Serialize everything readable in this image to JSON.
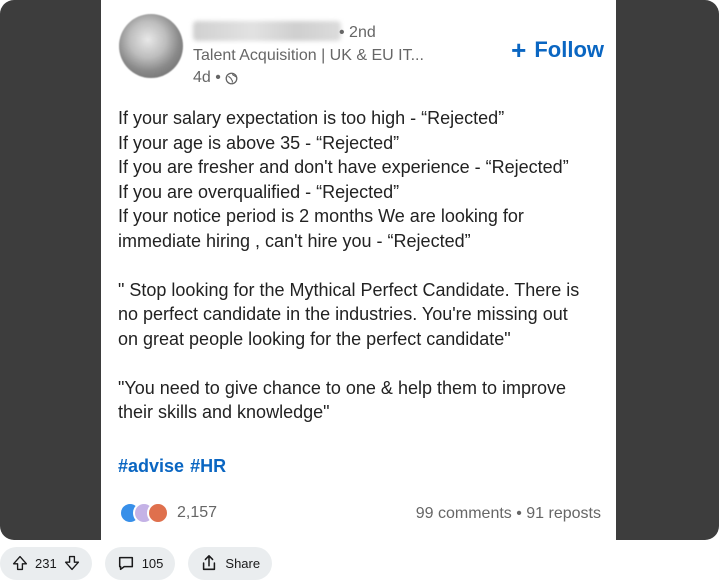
{
  "post": {
    "degree": "• 2nd",
    "headline": "Talent Acquisition | UK & EU IT...",
    "time": "4d •",
    "follow_label": "Follow",
    "body_lines": [
      "If your salary expectation is too high - “Rejected”",
      "If your age is above 35 - “Rejected”",
      "If you are fresher and don't have experience - “Rejected”",
      "If you are overqualified - “Rejected”",
      "If your notice period is 2 months We are looking for",
      "immediate hiring , can't hire you - “Rejected”",
      "",
      "\" Stop looking for the Mythical Perfect Candidate. There is",
      "no perfect candidate in the industries. You're missing out",
      "on great people looking for the perfect candidate\"",
      "",
      "\"You need to give chance to one & help them to improve",
      "their skills and knowledge\""
    ],
    "hashtags": [
      "#advise",
      "#HR"
    ],
    "reaction_count": "2,157",
    "social_counts": "99 comments • 91 reposts"
  },
  "actions": {
    "vote_count": "231",
    "comment_count": "105",
    "share_label": "Share"
  },
  "colors": {
    "link_blue": "#0a66c2",
    "media_bg": "#3d3d3d",
    "pill_bg": "#eaedef"
  },
  "icons": {
    "upvote": "arrow-up-icon",
    "downvote": "arrow-down-icon",
    "comment": "comment-bubble-icon",
    "share": "share-icon",
    "globe": "globe-icon",
    "plus": "plus-icon"
  }
}
